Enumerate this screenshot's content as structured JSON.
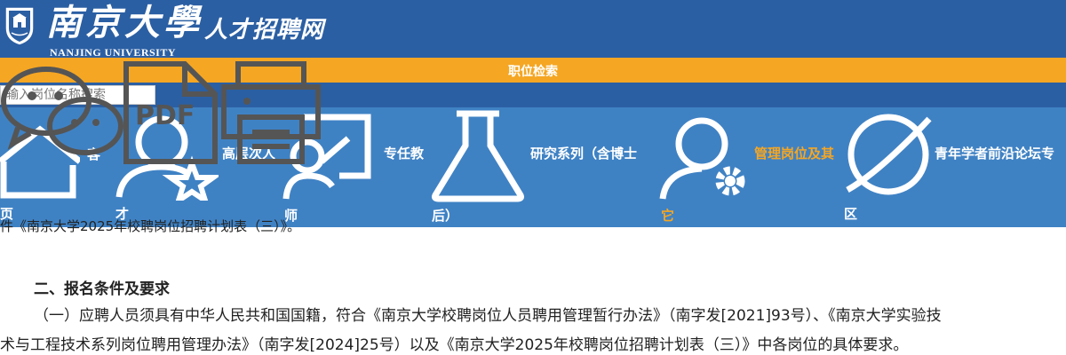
{
  "header": {
    "brand_script": "南京大學",
    "brand_sub": "NANJING UNIVERSITY",
    "site_title": "人才招聘网"
  },
  "orange_bar": {
    "label": "职位检索"
  },
  "search": {
    "placeholder": "输入岗位名称搜索"
  },
  "nav": {
    "items": [
      {
        "line1": "",
        "line2": "页"
      },
      {
        "line1": "",
        "line2": "才"
      },
      {
        "line1": "高层次人",
        "line2": ""
      },
      {
        "line1": "专任教",
        "line2": "师"
      },
      {
        "line1": "研究系列（含博士",
        "line2": "后）"
      },
      {
        "line1": "管理岗位及其",
        "line2": "它"
      },
      {
        "line1": "青年学者前沿论坛专",
        "line2": "区"
      }
    ],
    "fragment_ke": "客",
    "active_color": "#f5a623"
  },
  "content": {
    "partial_line": "件《南京大学2025年校聘岗位招聘计划表（三）》。",
    "section_heading": "二、报名条件及要求",
    "para1_line1": "（一）应聘人员须具有中华人民共和国国籍，符合《南京大学校聘岗位人员聘用管理暂行办法》（南字发[2021]93号）、《南京大学实验技",
    "para1_line2": "术与工程技术系列岗位聘用管理办法》（南字发[2024]25号）以及《南京大学2025年校聘岗位招聘计划表（三）》中各岗位的具体要求。"
  },
  "floating": {
    "pdf_label": "PDF"
  },
  "colors": {
    "header_blue": "#2b5fa3",
    "nav_blue": "#3f82c4",
    "orange": "#f5a623"
  }
}
